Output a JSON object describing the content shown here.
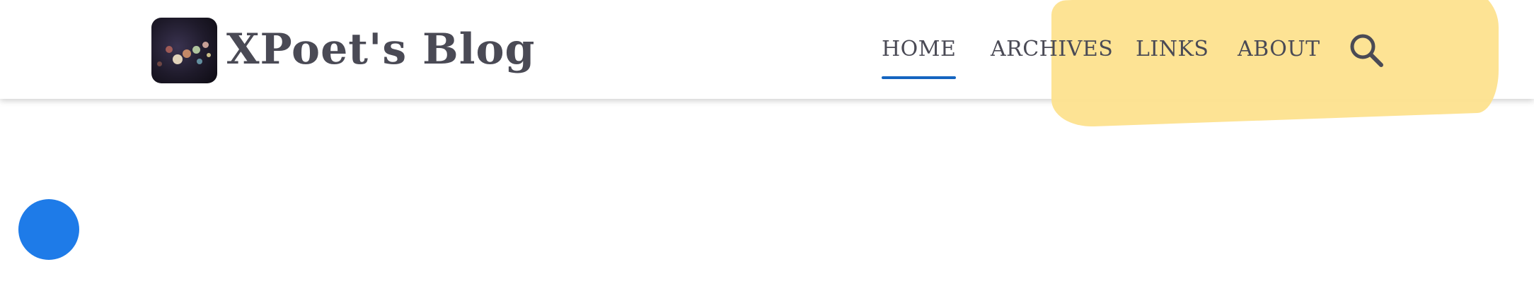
{
  "site": {
    "title": "XPoet's Blog"
  },
  "nav": {
    "items": [
      {
        "label": "HOME",
        "active": true
      },
      {
        "label": "ARCHIVES",
        "active": false
      },
      {
        "label": "LINKS",
        "active": false
      },
      {
        "label": "ABOUT",
        "active": false
      }
    ],
    "search_icon": "search-icon"
  },
  "colors": {
    "accent": "#1565c0",
    "highlight": "#fde28e",
    "fab": "#1e7be8",
    "text": "#4a4a55"
  }
}
